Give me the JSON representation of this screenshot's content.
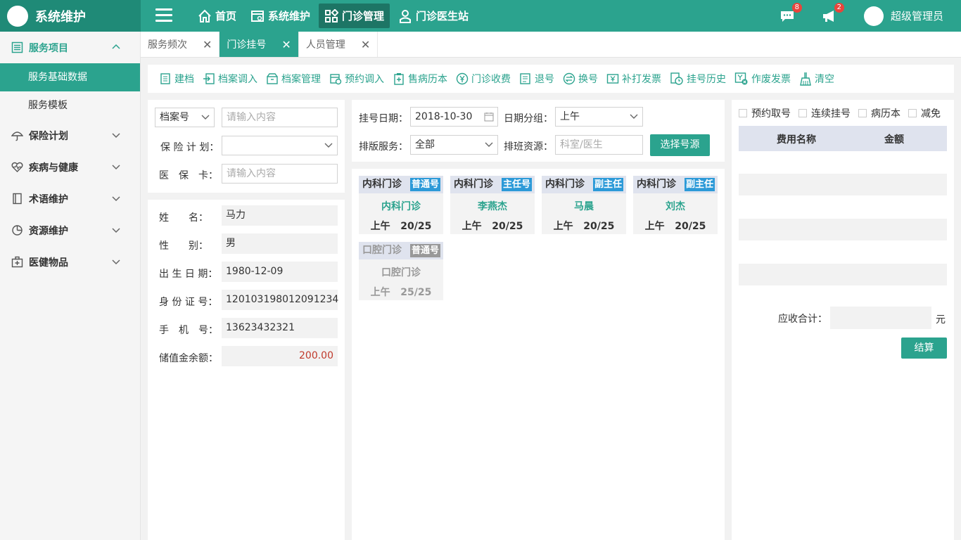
{
  "app": {
    "title": "系统维护"
  },
  "topnav": [
    {
      "label": "首页",
      "icon": "home-icon"
    },
    {
      "label": "系统维护",
      "icon": "system-settings-icon"
    },
    {
      "label": "门诊管理",
      "icon": "apps-grid-icon"
    },
    {
      "label": "门诊医生站",
      "icon": "doctor-icon"
    }
  ],
  "notifications": {
    "messages": "8",
    "announcements": "2"
  },
  "user": {
    "name": "超级管理员"
  },
  "sidebar": {
    "groups": [
      {
        "label": "服务项目",
        "icon": "list-icon"
      },
      {
        "label": "保险计划",
        "icon": "umbrella-icon"
      },
      {
        "label": "疾病与健康",
        "icon": "heart-pulse-icon"
      },
      {
        "label": "术语维护",
        "icon": "book-icon"
      },
      {
        "label": "资源维护",
        "icon": "pie-chart-icon"
      },
      {
        "label": "医健物品",
        "icon": "medical-kit-icon"
      }
    ],
    "sub_items": [
      "服务基础数据",
      "服务模板"
    ]
  },
  "tabs": [
    "服务频次",
    "门诊挂号",
    "人员管理"
  ],
  "toolbar": [
    "建档",
    "档案调入",
    "档案管理",
    "预约调入",
    "售病历本",
    "门诊收费",
    "退号",
    "换号",
    "补打发票",
    "挂号历史",
    "作废发票",
    "清空"
  ],
  "search": {
    "type_select": "档案号",
    "placeholder": "请输入内容",
    "plan_label": "保 险 计 划：",
    "card_label": "医　保　卡：",
    "card_placeholder": "请输入内容"
  },
  "patient": {
    "fields": [
      {
        "label": "姓　　名：",
        "value": "马力"
      },
      {
        "label": "性　　别：",
        "value": "男"
      },
      {
        "label": "出 生 日 期：",
        "value": "1980-12-09"
      },
      {
        "label": "身 份 证 号：",
        "value": "120103198012091234"
      },
      {
        "label": "手　机　号：",
        "value": "13623432321"
      },
      {
        "label": "储值金余额：",
        "value": "200.00"
      }
    ]
  },
  "registration": {
    "date_label": "挂号日期：",
    "date_value": "2018-10-30",
    "group_label": "日期分组：",
    "group_value": "上午",
    "service_label": "排版服务：",
    "service_value": "全部",
    "resource_label": "排班资源：",
    "resource_placeholder": "科室/医生",
    "select_button": "选择号源"
  },
  "slots": [
    {
      "dept": "内科门诊",
      "tag": "普通号",
      "name": "内科门诊",
      "period": "上午",
      "count": "20/25",
      "disabled": false
    },
    {
      "dept": "内科门诊",
      "tag": "主任号",
      "name": "李燕杰",
      "period": "上午",
      "count": "20/25",
      "disabled": false
    },
    {
      "dept": "内科门诊",
      "tag": "副主任",
      "name": "马晨",
      "period": "上午",
      "count": "20/25",
      "disabled": false
    },
    {
      "dept": "内科门诊",
      "tag": "副主任",
      "name": "刘杰",
      "period": "上午",
      "count": "20/25",
      "disabled": false
    },
    {
      "dept": "口腔门诊",
      "tag": "普通号",
      "name": "口腔门诊",
      "period": "上午",
      "count": "25/25",
      "disabled": true
    }
  ],
  "fees": {
    "options": [
      "预约取号",
      "连续挂号",
      "病历本",
      "减免"
    ],
    "col_name": "费用名称",
    "col_amount": "金额",
    "total_label": "应收合计：",
    "unit": "元",
    "settle_button": "结算"
  },
  "colors": {
    "primary": "#2ba38e",
    "accent_tag": "#2c9ad8",
    "badge": "#e8453c",
    "balance": "#c0392b"
  }
}
